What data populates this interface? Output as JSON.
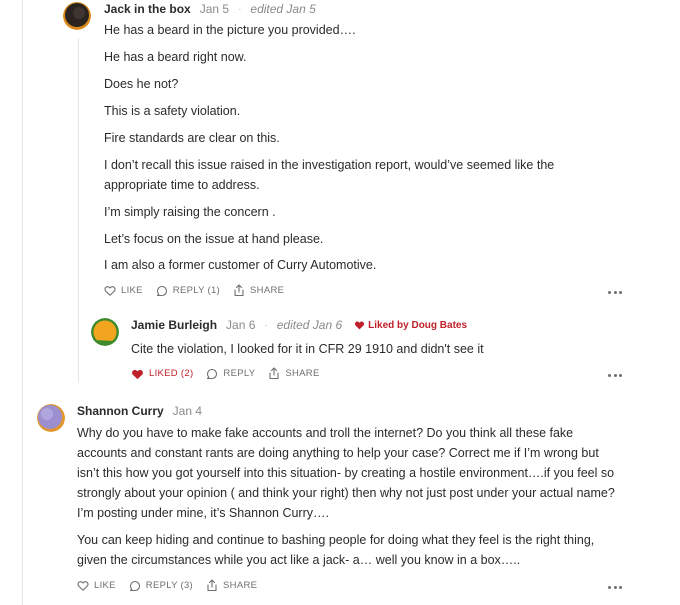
{
  "comments": [
    {
      "author": "Jack in the box",
      "date": "Jan 5",
      "edited": "edited Jan 5",
      "paragraphs": [
        "He has a beard in the picture you provided….",
        "He has a beard right now.",
        "Does he not?",
        "This is a safety violation.",
        "Fire standards are clear on this.",
        "I don’t recall this issue raised in the investigation report, would’ve seemed like the",
        "appropriate time to address.",
        "I’m simply raising the concern .",
        "Let’s focus on the issue at hand please.",
        "I am also a former customer of Curry Automotive."
      ],
      "actions": {
        "like": "LIKE",
        "reply": "REPLY (1)",
        "share": "SHARE"
      }
    },
    {
      "author": "Jamie Burleigh",
      "date": "Jan 6",
      "edited": "edited Jan 6",
      "liked_by": "Liked by Doug Bates",
      "paragraphs": [
        "Cite the violation, I looked for it in CFR 29 1910 and didn't see it"
      ],
      "actions": {
        "like": "LIKED (2)",
        "reply": "REPLY",
        "share": "SHARE"
      }
    },
    {
      "author": "Shannon Curry",
      "date": "Jan 4",
      "paragraphs": [
        "Why do you have to make fake accounts and troll the internet? Do you think all these fake",
        "accounts and constant rants are doing anything to help your case? Correct me if I’m wrong but",
        "isn’t this how you got yourself into this situation- by creating a hostile environment….if you feel so",
        "strongly about your opinion ( and think your right) then why not just post under your actual name?",
        "I’m posting under mine, it’s Shannon Curry….",
        "You can keep hiding and continue to bashing people for doing what they feel is the right thing,",
        "given the circumstances while you act like a jack- a… well you know in a box….."
      ],
      "actions": {
        "like": "LIKE",
        "reply": "REPLY (3)",
        "share": "SHARE"
      }
    }
  ],
  "colors": {
    "liked": "#c0202a",
    "text": "#2b2b2b",
    "muted": "#8a8a8a"
  }
}
